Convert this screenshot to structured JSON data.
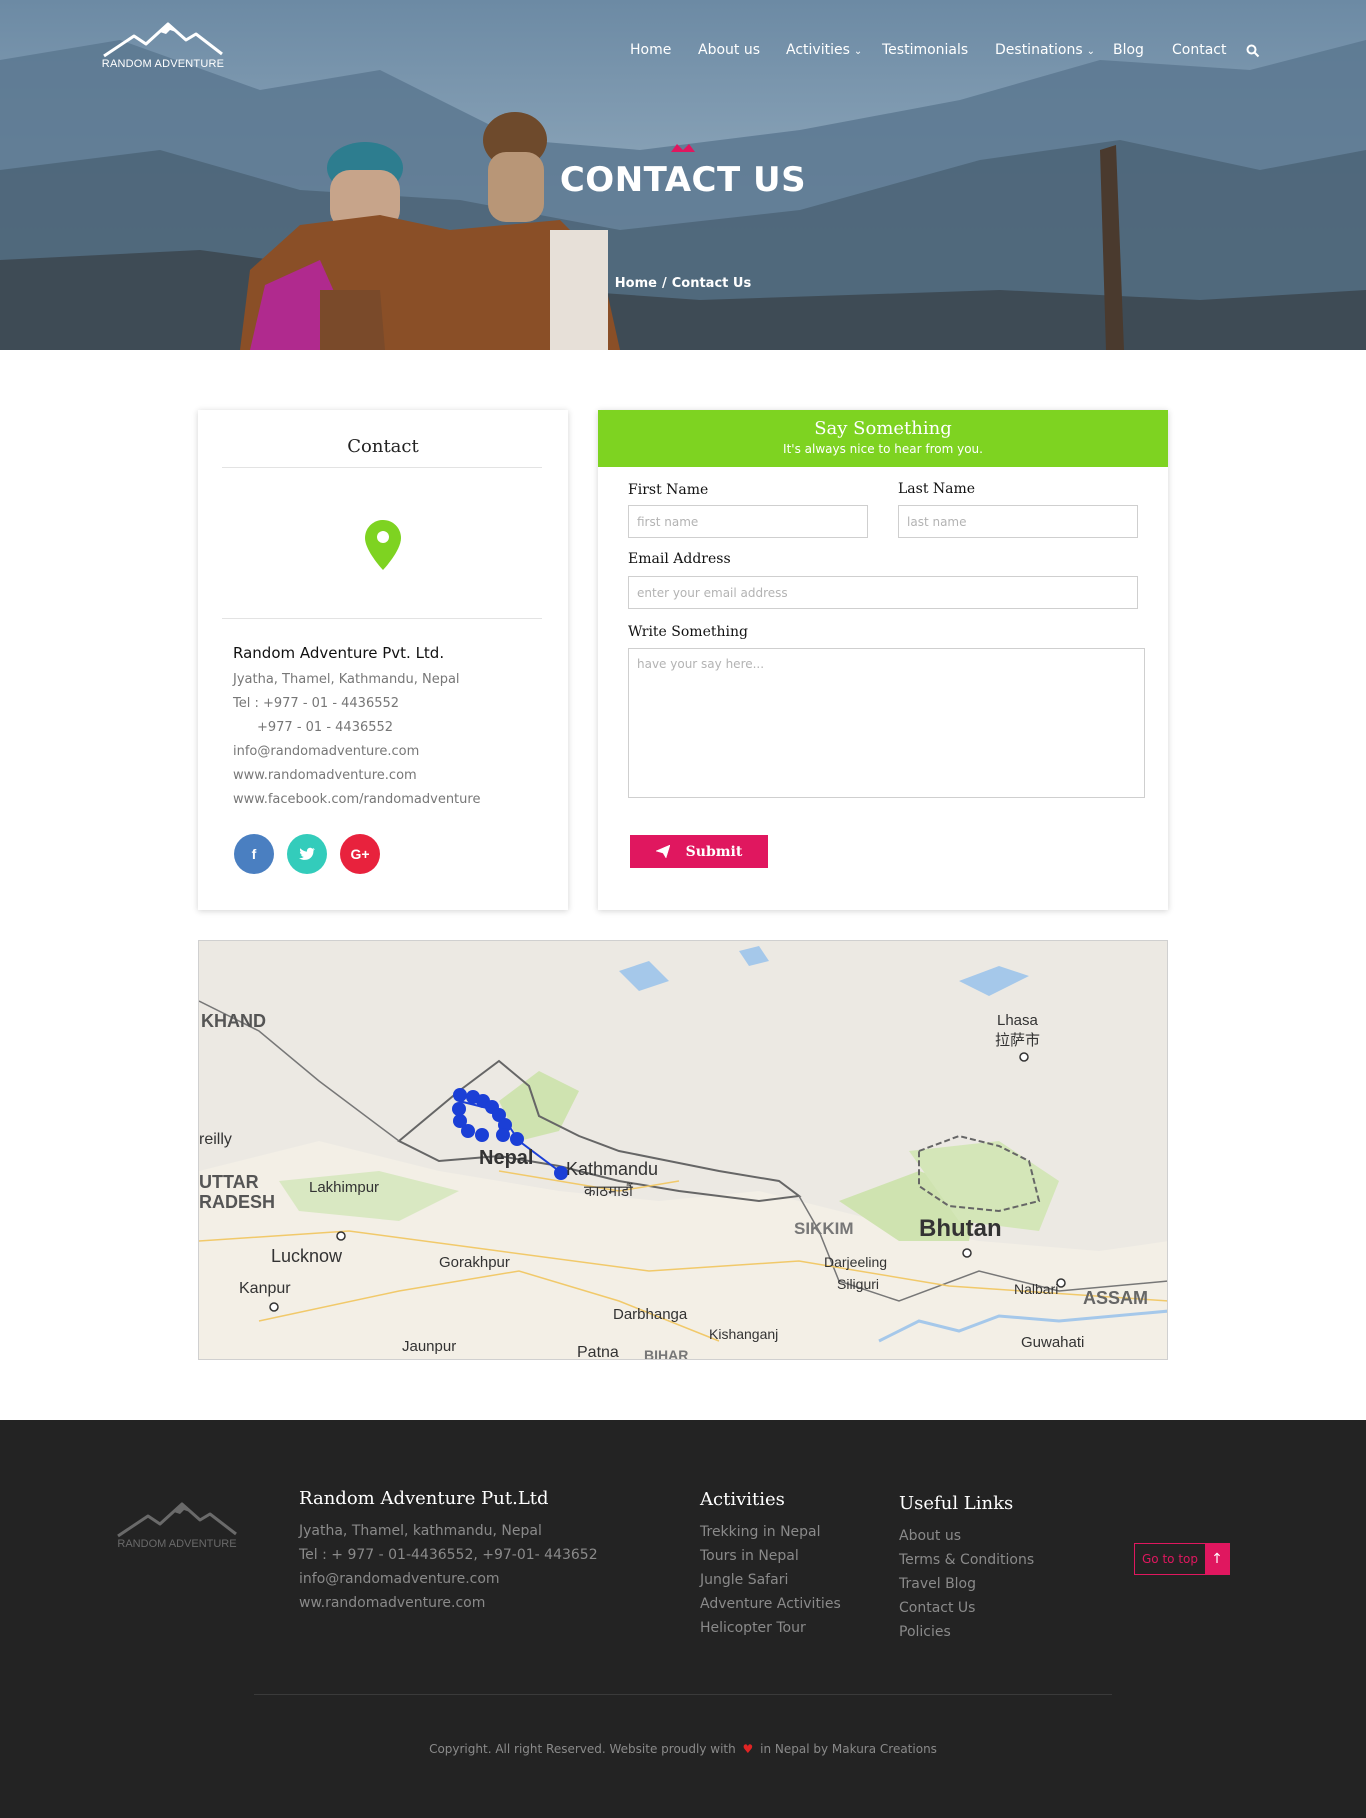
{
  "brand": {
    "logo_text": "RANDOM ADVENTURE"
  },
  "nav": {
    "items": [
      {
        "label": "Home"
      },
      {
        "label": "About us"
      },
      {
        "label": "Activities"
      },
      {
        "label": "Testimonials"
      },
      {
        "label": "Destinations"
      },
      {
        "label": "Blog"
      },
      {
        "label": "Contact"
      }
    ],
    "search_icon": "search-icon"
  },
  "hero": {
    "title": "CONTACT US",
    "breadcrumb": {
      "home": "Home",
      "separator": "/",
      "current": "Contact Us"
    }
  },
  "contact": {
    "heading": "Contact",
    "company": "Random Adventure Pvt. Ltd.",
    "address": "Jyatha, Thamel, Kathmandu, Nepal",
    "tel1": "Tel : +977 - 01 - 4436552",
    "tel2": "+977 - 01 - 4436552",
    "email": "info@randomadventure.com",
    "website": "www.randomadventure.com",
    "facebook": "www.facebook.com/randomadventure",
    "social": [
      {
        "icon": "facebook-icon",
        "glyph": "f",
        "color": "#4a7fc1"
      },
      {
        "icon": "twitter-icon",
        "glyph": "t",
        "color": "#33ccbb"
      },
      {
        "icon": "google-plus-icon",
        "glyph": "G+",
        "color": "#e8223d"
      }
    ]
  },
  "form": {
    "title": "Say Something",
    "subtitle": "It's always nice to hear from you.",
    "first_name_label": "First Name",
    "first_name_placeholder": "first name",
    "last_name_label": "Last Name",
    "last_name_placeholder": "last name",
    "email_label": "Email Address",
    "email_placeholder": "enter your email address",
    "message_label": "Write Something",
    "message_placeholder": "have your say here...",
    "submit_label": "Submit",
    "accent": "#7ed321",
    "button_color": "#e0175f"
  },
  "map": {
    "labels": [
      "KHAND",
      "Lhasa",
      "拉萨市",
      "reilly",
      "UTTAR",
      "RADESH",
      "Lakhimpur",
      "Nepal",
      "Kathmandu",
      "काठमाडौं",
      "SIKKIM",
      "Bhutan",
      "Lucknow",
      "Gorakhpur",
      "Darjeeling",
      "Siliguri",
      "Nalbari",
      "ASSAM",
      "Kanpur",
      "Darbhanga",
      "Kishanganj",
      "Guwahati",
      "Jaunpur",
      "Patna",
      "BIHAR"
    ]
  },
  "footer": {
    "logo_text": "RANDOM ADVENTURE",
    "company_heading": "Random Adventure Put.Ltd",
    "address": "Jyatha, Thamel, kathmandu, Nepal",
    "tel": "Tel : + 977 - 01-4436552, +97-01- 443652",
    "email": "info@randomadventure.com",
    "website": "ww.randomadventure.com",
    "activities_heading": "Activities",
    "activities": [
      "Trekking in Nepal",
      "Tours in Nepal",
      "Jungle Safari",
      "Adventure Activities",
      "Helicopter Tour"
    ],
    "links_heading": "Useful Links",
    "links": [
      "About us",
      "Terms & Conditions",
      "Travel Blog",
      "Contact Us",
      "Policies"
    ],
    "go_to_top": "Go to top",
    "copyright_before": "Copyright. All right Reserved. Website proudly with",
    "copyright_after": "in Nepal by Makura Creations"
  }
}
